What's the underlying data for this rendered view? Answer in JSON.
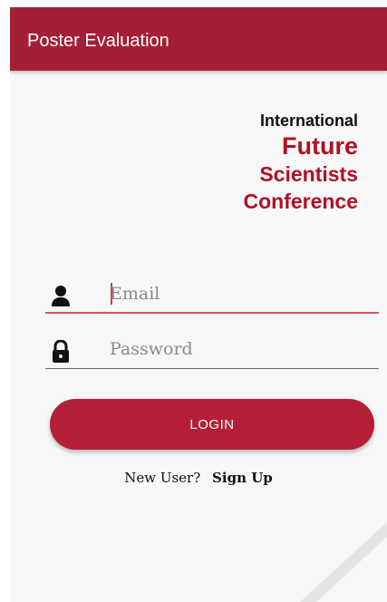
{
  "app_bar": {
    "title": "Poster Evaluation",
    "color": "#a41f35"
  },
  "logo": {
    "line1": "International",
    "line2": "Future",
    "line3": "Scientists",
    "line4": "Conference",
    "accent_color": "#b01025"
  },
  "form": {
    "email": {
      "placeholder": "Email",
      "value": "",
      "icon": "person-icon",
      "focused": true
    },
    "password": {
      "placeholder": "Password",
      "value": "",
      "icon": "lock-icon"
    },
    "login_label": "LOGIN"
  },
  "signup": {
    "prompt": "New User?",
    "link_label": "Sign Up"
  }
}
